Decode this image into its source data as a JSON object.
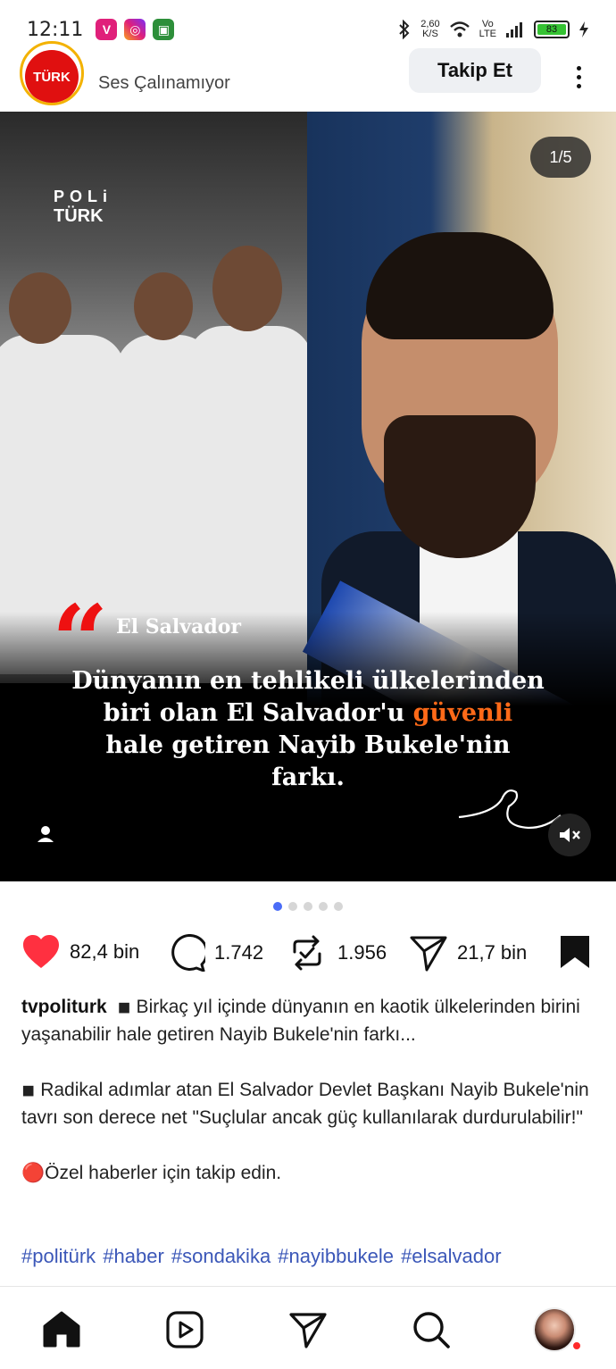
{
  "status_bar": {
    "time": "12:11",
    "net_speed": "2,60",
    "net_speed_unit": "K/S",
    "volte_top": "Vo",
    "volte_bottom": "LTE",
    "battery": "83"
  },
  "post_header": {
    "account_logo_text": "TÜRK",
    "audio_status": "Ses Çalınamıyor",
    "follow_label": "Takip Et"
  },
  "media": {
    "brand_line1": "POLi",
    "brand_line2": "TÜRK",
    "counter": "1/5",
    "quote_mark": "“",
    "caption_label": "El Salvador",
    "caption_line1": "Dünyanın en tehlikeli ülkelerinden",
    "caption_line2_a": "biri olan  El Salvador'u ",
    "caption_line2_highlight": "güvenli",
    "caption_line3": "hale getiren Nayib Bukele'nin",
    "caption_line4": "farkı."
  },
  "carousel": {
    "total": 5,
    "active": 0
  },
  "actions": {
    "likes": "82,4 bin",
    "comments": "1.742",
    "reposts": "1.956",
    "shares": "21,7 bin"
  },
  "post": {
    "username": "tvpoliturk",
    "paragraph1": "◾ Birkaç yıl içinde dünyanın en kaotik ülkelerinden birini yaşanabilir hale getiren Nayib Bukele'nin farkı...",
    "paragraph2": "◾ Radikal adımlar atan El Salvador Devlet Başkanı Nayib Bukele'nin tavrı son derece net \"Suçlular ancak güç kullanılarak durdurulabilir!\"",
    "paragraph3": "🔴Özel haberler için takip edin.",
    "hashtags": "#politürk #haber #sondakika #nayibbukele #elsalvador"
  },
  "colors": {
    "like_red": "#ff3040",
    "hashtag_blue": "#3b57b8",
    "caption_highlight": "#ff6a18",
    "active_dot": "#4a6cf7"
  },
  "icons": {
    "nav": [
      "home-icon",
      "reels-icon",
      "send-icon",
      "search-icon",
      "profile-avatar"
    ]
  }
}
